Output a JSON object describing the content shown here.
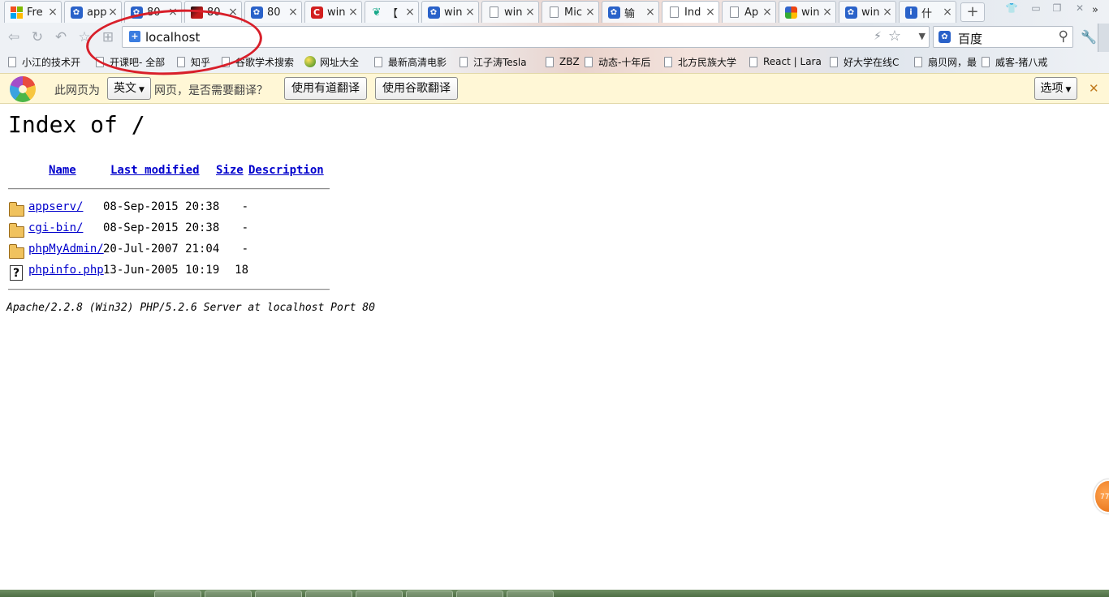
{
  "tabs": [
    {
      "title": "Fre",
      "icon": "windows-logo-icon"
    },
    {
      "title": "app",
      "icon": "baidu-paw-icon"
    },
    {
      "title": "80",
      "icon": "baidu-paw-icon"
    },
    {
      "title": "80",
      "icon": "red-site-icon"
    },
    {
      "title": "80",
      "icon": "baidu-paw-icon"
    },
    {
      "title": "win",
      "icon": "csdn-c-icon"
    },
    {
      "title": "【",
      "icon": "leaf-icon"
    },
    {
      "title": "win",
      "icon": "baidu-paw-icon"
    },
    {
      "title": "win",
      "icon": "page-icon"
    },
    {
      "title": "Mic",
      "icon": "page-icon"
    },
    {
      "title": "输",
      "icon": "baidu-paw-icon"
    },
    {
      "title": "Ind",
      "icon": "page-icon",
      "active": true
    },
    {
      "title": "Ap",
      "icon": "page-icon"
    },
    {
      "title": "win",
      "icon": "rainbow-icon"
    },
    {
      "title": "win",
      "icon": "baidu-paw-icon"
    },
    {
      "title": "什",
      "icon": "info-icon"
    }
  ],
  "new_tab_label": "+",
  "url": "localhost",
  "search_engine": "百度",
  "bookmarks": [
    "小江的技术开",
    "开课吧- 全部",
    "知乎",
    "谷歌学术搜索",
    "网址大全",
    "最新高清电影",
    "江子涛Tesla",
    "ZBZ",
    "动态-十年后",
    "北方民族大学",
    "React | Lara",
    "好大学在线C",
    "扇贝网，最",
    "威客-猪八戒"
  ],
  "bookmarks_more": "»",
  "translate_bar": {
    "prefix": "此网页为",
    "language": "英文",
    "question": "网页，是否需要翻译？",
    "youdao_button": "使用有道翻译",
    "google_button": "使用谷歌翻译",
    "options_button": "选项",
    "close": "✕"
  },
  "page": {
    "title": "Index of /",
    "columns": {
      "name": "Name",
      "modified": "Last modified",
      "size": "Size",
      "description": "Description"
    },
    "rows": [
      {
        "name": "appserv/",
        "modified": "08-Sep-2015 20:38",
        "size": "-",
        "type": "folder"
      },
      {
        "name": "cgi-bin/",
        "modified": "08-Sep-2015 20:38",
        "size": "-",
        "type": "folder"
      },
      {
        "name": "phpMyAdmin/",
        "modified": "20-Jul-2007 21:04",
        "size": "-",
        "type": "folder"
      },
      {
        "name": "phpinfo.php",
        "modified": "13-Jun-2005 10:19",
        "size": "18",
        "type": "unknown-file"
      }
    ],
    "server_signature": "Apache/2.2.8 (Win32) PHP/5.2.6 Server at localhost Port 80"
  },
  "float_badge": "77",
  "colors": {
    "link": "#0000cc",
    "annotation": "#d81f2a",
    "translate_bar_bg": "#fff7d6"
  }
}
